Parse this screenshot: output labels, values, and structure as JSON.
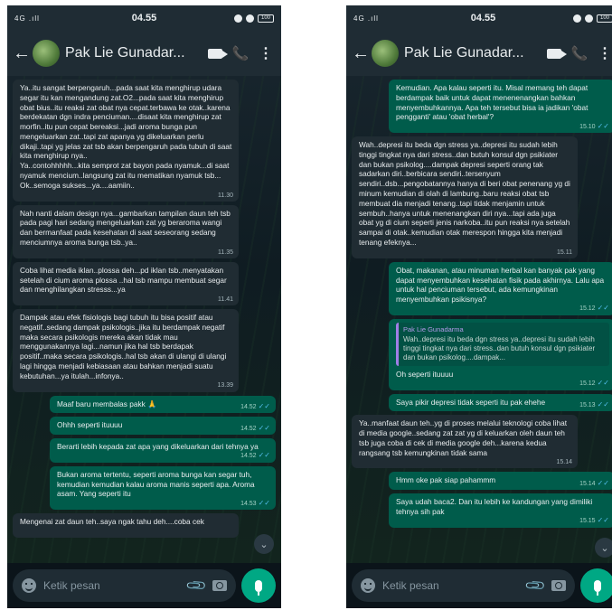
{
  "status": {
    "signal": "4G .ıll",
    "time": "04.55",
    "battery": "100"
  },
  "contact": {
    "name": "Pak Lie Gunadar..."
  },
  "input": {
    "placeholder": "Ketik pesan"
  },
  "left": {
    "messages": [
      {
        "dir": "in",
        "text": "Ya..itu sangat berpengaruh...pada saat kita menghirup udara segar itu kan mengandung zat.O2...pada saat kita menghirup obat bius..itu reaksi zat obat nya cepat.terbawa ke otak..karena berdekatan dgn indra penciuman....disaat kita menghirup zat morfin..itu pun cepat bereaksi...jadi aroma bunga pun mengeluarkan zat..tapi zat apanya yg dikeluarkan perlu dikaji..tapi yg jelas zat tsb akan berpengaruh pada tubuh di saat kita menghirup nya..\nYa..contohhhhh...kita semprot zat bayon pada nyamuk...di saat nyamuk mencium..langsung zat itu mematikan nyamuk tsb...\nOk..semoga sukses...ya....aamiin..",
        "time": "11.30"
      },
      {
        "dir": "in",
        "text": "Nah nanti dalam design nya...gambarkan tampilan daun teh tsb pada pagi hari sedang mengeluarkan zat yg beraroma wangi dan bermanfaat pada kesehatan di saat seseorang sedang menciumnya aroma bunga tsb..ya..",
        "time": "11.35"
      },
      {
        "dir": "in",
        "text": "Coba lihat media iklan..plossa deh...pd iklan tsb..menyatakan setelah di cium aroma plossa ..hal tsb mampu membuat segar dan menghilangkan stresss...ya",
        "time": "11.41"
      },
      {
        "dir": "in",
        "text": "Dampak atau efek fisiologis bagi tubuh itu bisa positif atau negatif..sedang dampak psikologis..jika itu berdampak negatif maka secara psikologis mereka akan tidak mau menggunakannya lagi...namun jika hal tsb berdapak positif..maka secara psikologis..hal tsb akan di ulangi di ulangi lagi hingga menjadi kebiasaan atau bahkan menjadi suatu kebutuhan...ya itulah...infonya..",
        "time": "13.39"
      },
      {
        "dir": "out",
        "text": "Maaf baru membalas pakk 🙏",
        "time": "14.52",
        "small": true
      },
      {
        "dir": "out",
        "text": "Ohhh seperti ituuuu",
        "time": "14.52",
        "small": true
      },
      {
        "dir": "out",
        "text": "Berarti lebih kepada zat apa yang dikeluarkan dari tehnya ya",
        "time": "14.52"
      },
      {
        "dir": "out",
        "text": "Bukan aroma tertentu, seperti aroma bunga kan segar tuh, kemudian kemudian kalau aroma manis seperti apa. Aroma asam. Yang seperti itu",
        "time": "14.53"
      },
      {
        "dir": "in",
        "text": "Mengenai zat daun teh..saya ngak tahu deh....coba cek",
        "time": ""
      }
    ]
  },
  "right": {
    "messages": [
      {
        "dir": "out",
        "text": "Kemudian. Apa kalau seperti itu. Misal memang teh dapat berdampak baik untuk dapat menenenangkan bahkan menyembuhkannya. Apa teh tersebut bisa ia jadikan 'obat pengganti' atau 'obat herbal'?",
        "time": "15.10"
      },
      {
        "dir": "in",
        "text": "Wah..depresi itu beda dgn stress ya..depresi itu sudah lebih tinggi tingkat nya dari stress..dan butuh konsul dgn psikiater dan bukan psikolog....dampak depresi seperti orang tak sadarkan diri..berbicara sendiri..tersenyum sendiri..dsb...pengobatannya hanya di beri obat penenang yg di minum kemudian di olah di lambung..baru reaksi obat tsb membuat dia menjadi tenang..tapi tidak menjamin untuk sembuh..hanya untuk menenangkan diri nya...tapi ada juga obat yg di cium seperti jenis narkoba..itu pun reaksi nya setelah sampai di otak..kemudian otak merespon hingga kita menjadi tenang efeknya...",
        "time": "15.11"
      },
      {
        "dir": "out",
        "text": "Obat, makanan, atau minuman herbal kan banyak pak yang dapat menyembuhkan kesehatan fisik pada akhirnya. Lalu apa untuk hal penciuman tersebut, ada kemungkinan menyembuhkan psikisnya?",
        "time": "15.12"
      },
      {
        "dir": "out",
        "quote_name": "Pak Lie Gunadarma",
        "quote_text": "Wah..depresi itu beda dgn stress ya..depresi itu sudah lebih tinggi tingkat nya dari stress..dan butuh konsul dgn psikiater dan bukan psikolog....dampak...",
        "text": "Oh seperti ituuuu",
        "time": "15.12"
      },
      {
        "dir": "out",
        "text": "Saya pikir depresi tidak seperti itu pak ehehe",
        "time": "15.13",
        "small": true
      },
      {
        "dir": "in",
        "text": "Ya..manfaat daun teh..yg di proses melalui teknologi coba lihat di media google..sedang zat zat yg di keluarkan oleh daun teh tsb juga coba di cek di media google deh...karena kedua rangsang tsb kemungkinan tidak sama",
        "time": "15.14"
      },
      {
        "dir": "out",
        "text": "Hmm oke pak siap pahammm",
        "time": "15.14",
        "small": true
      },
      {
        "dir": "out",
        "text": "Saya udah baca2. Dan itu lebih ke kandungan yang dimiliki tehnya sih pak",
        "time": "15.15"
      }
    ]
  }
}
